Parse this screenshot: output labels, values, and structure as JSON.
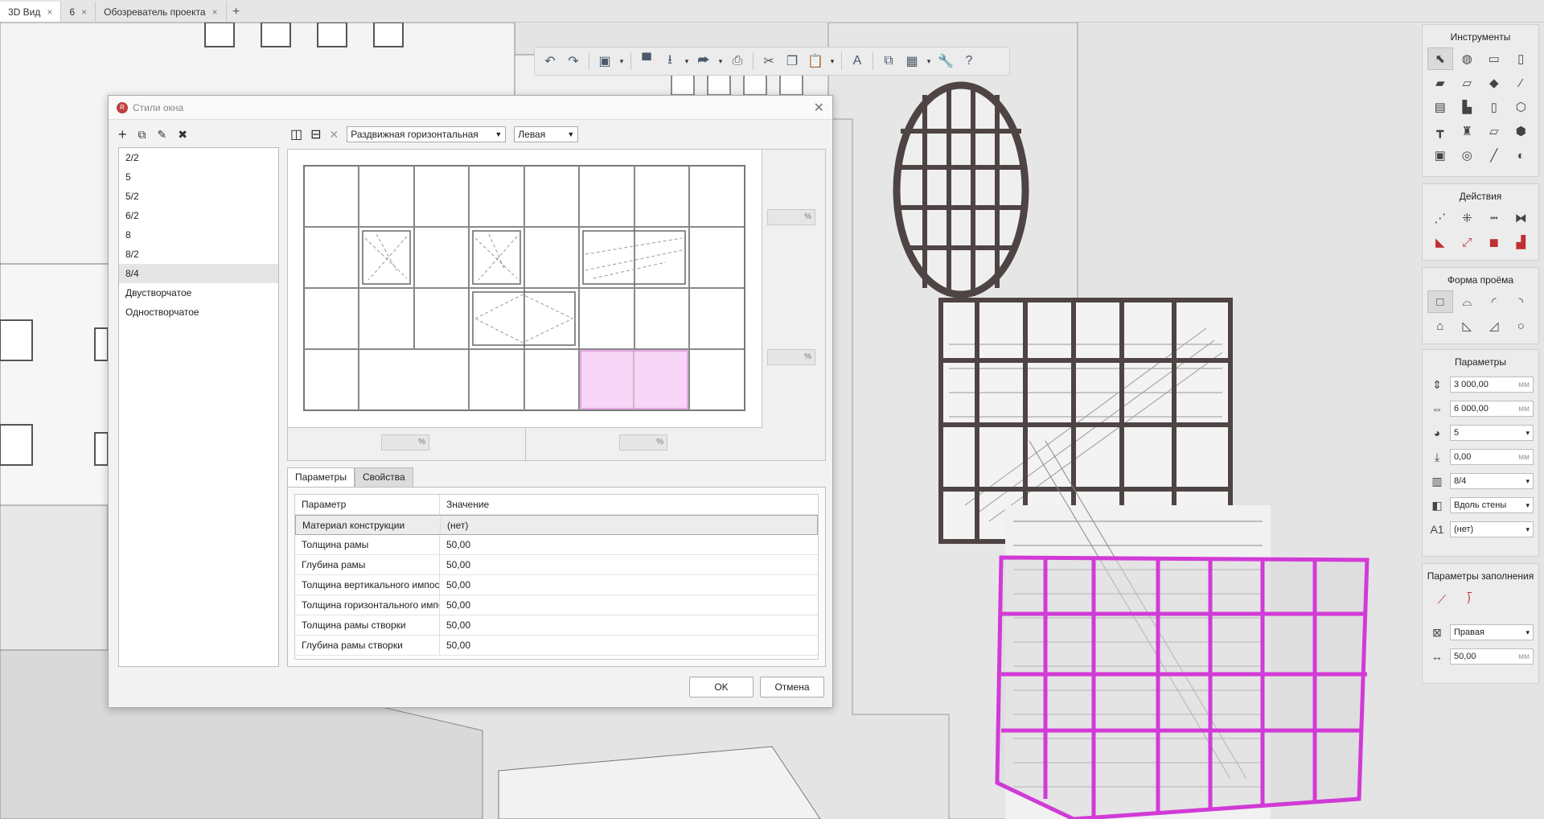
{
  "tabs": [
    {
      "label": "3D Вид",
      "active": true
    },
    {
      "label": "6",
      "active": false
    },
    {
      "label": "Обозреватель проекта",
      "active": false
    }
  ],
  "tab_close": "×",
  "tab_add": "+",
  "toolbar": {
    "undo": "↶",
    "redo": "↷",
    "cube": "▣",
    "folder": "▀",
    "save": "⭳",
    "export": "⮫",
    "print": "⎙",
    "cut": "✂",
    "copy": "❐",
    "paste": "📋",
    "text": "A",
    "layers": "⧉",
    "table": "▦",
    "wrench": "🔧",
    "help": "?",
    "dropdown": "▾"
  },
  "dialog": {
    "title": "Стили окна",
    "logo": "R",
    "close": "✕",
    "list_toolbar": {
      "add": "+",
      "duplicate": "⧉",
      "edit": "✎",
      "delete": "✖"
    },
    "styles": [
      "2/2",
      "5",
      "5/2",
      "6/2",
      "8",
      "8/2",
      "8/4",
      "Двустворчатое",
      "Одностворчатое"
    ],
    "selected_style": "8/4",
    "right_toolbar": {
      "split_v": "◫",
      "split_h": "⊟",
      "remove": "✕"
    },
    "opening_type": "Раздвижная горизонтальная",
    "opening_side": "Левая",
    "percent": "%",
    "tabs": [
      "Параметры",
      "Свойства"
    ],
    "table": {
      "headers": [
        "Параметр",
        "Значение"
      ],
      "rows": [
        [
          "Материал конструкции",
          "(нет)"
        ],
        [
          "Толщина рамы",
          "50,00"
        ],
        [
          "Глубина рамы",
          "50,00"
        ],
        [
          "Толщина вертикального импоста",
          "50,00"
        ],
        [
          "Толщина горизонтального импоста",
          "50,00"
        ],
        [
          "Толщина рамы створки",
          "50,00"
        ],
        [
          "Глубина рамы створки",
          "50,00"
        ]
      ]
    },
    "ok": "OK",
    "cancel": "Отмена"
  },
  "panels": {
    "tools": {
      "title": "Инструменты",
      "icons": [
        "cursor-icon",
        "paint-icon",
        "frame-icon",
        "door-icon",
        "wall-icon",
        "slab-icon",
        "roof-icon",
        "brush-icon",
        "beam-icon",
        "stair-icon",
        "window-icon",
        "cube-icon",
        "table-icon",
        "bottle-icon",
        "cut-icon",
        "shape3d-icon",
        "camera-icon",
        "ortho-icon",
        "line-icon",
        "hatch-icon"
      ],
      "glyphs": [
        "⬉",
        "◍",
        "▭",
        "▯",
        "▰",
        "▱",
        "◆",
        "⁄",
        "▤",
        "▙",
        "▯",
        "⬡",
        "┳",
        "♜",
        "▱",
        "⬢",
        "▣",
        "◎",
        "╱",
        "◐"
      ]
    },
    "actions": {
      "title": "Действия",
      "glyphs": [
        "⋰",
        "⁜",
        "┅",
        "⧓",
        "◣",
        "⤢",
        "◼",
        "▟"
      ]
    },
    "opening_form": {
      "title": "Форма проёма",
      "glyphs": [
        "□",
        "⌓",
        "◜",
        "◝",
        "⌂",
        "◺",
        "◿",
        "○"
      ]
    },
    "params": {
      "title": "Параметры",
      "rows": [
        {
          "icon": "⇕",
          "value": "3 000,00",
          "unit": "мм"
        },
        {
          "icon": "⇔",
          "value": "6 000,00",
          "unit": "мм"
        },
        {
          "icon": "◕",
          "value": "5",
          "unit": "▾"
        },
        {
          "icon": "⤓",
          "value": "0,00",
          "unit": "мм"
        },
        {
          "icon": "▥",
          "value": "8/4",
          "unit": "▾"
        },
        {
          "icon": "◧",
          "value": "Вдоль стены",
          "unit": "▾"
        },
        {
          "icon": "A1",
          "value": "(нет)",
          "unit": "▾"
        }
      ]
    },
    "fill": {
      "title": "Параметры заполнения",
      "icons": [
        "⟋",
        "⟌"
      ],
      "rows": [
        {
          "icon": "⊠",
          "value": "Правая",
          "unit": "▾"
        },
        {
          "icon": "↔",
          "value": "50,00",
          "unit": "мм"
        }
      ]
    }
  }
}
